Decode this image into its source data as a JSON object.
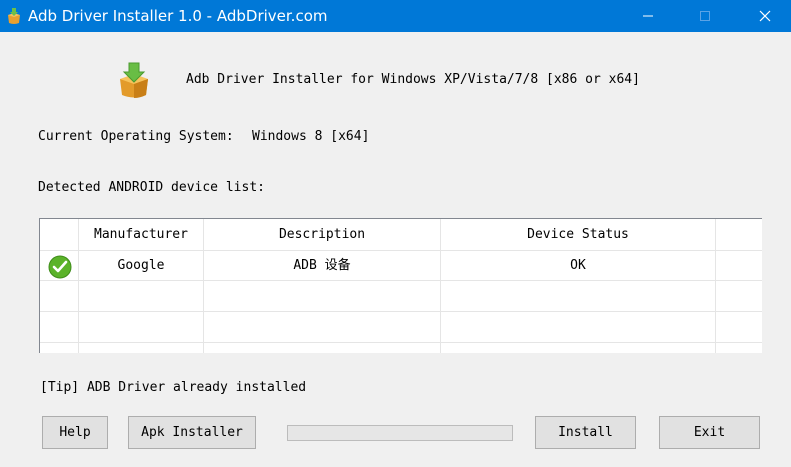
{
  "window": {
    "title": "Adb Driver Installer 1.0  -  AdbDriver.com",
    "title_color": "#0078d7"
  },
  "header": {
    "text": "Adb Driver Installer for Windows XP/Vista/7/8 [x86 or x64]",
    "logo_icon": "install-package-icon"
  },
  "os": {
    "label": "Current Operating System:",
    "value": "Windows 8  [x64]"
  },
  "devices": {
    "label": "Detected ANDROID device list:",
    "columns": [
      "Manufacturer",
      "Description",
      "Device Status"
    ],
    "rows": [
      {
        "status_icon": "check-icon",
        "manufacturer": "Google",
        "description": "ADB 设备",
        "status": "OK"
      }
    ]
  },
  "tip": "[Tip] ADB Driver already installed",
  "progress": {
    "value": 0
  },
  "buttons": {
    "help": "Help",
    "apk_installer": "Apk Installer",
    "install": "Install",
    "exit": "Exit"
  }
}
